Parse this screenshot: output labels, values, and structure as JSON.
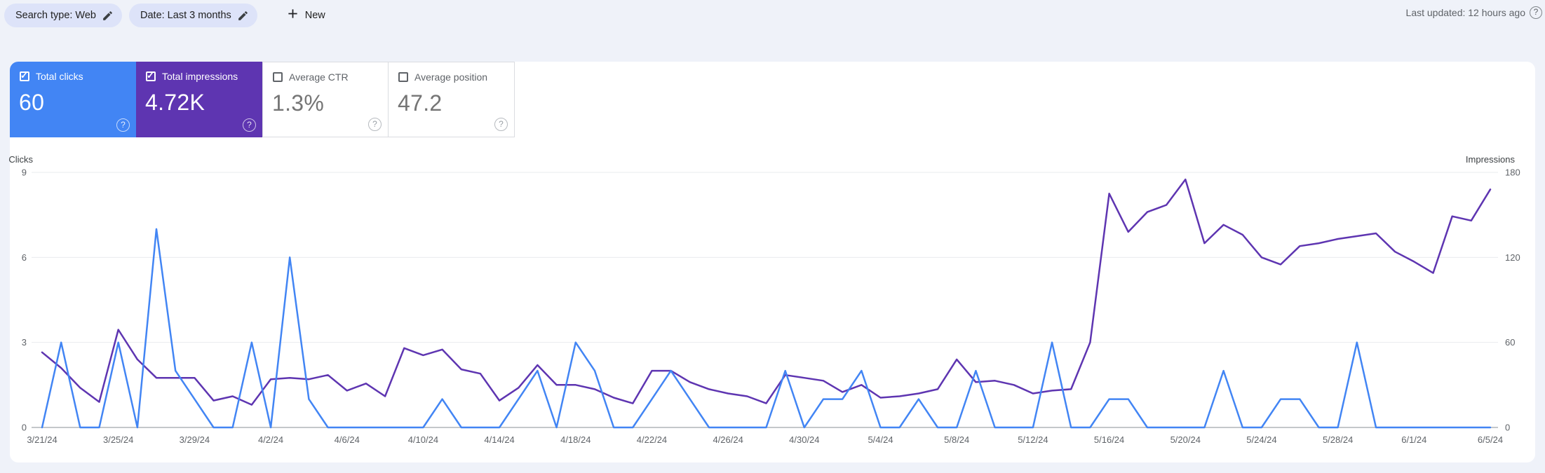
{
  "icons": {
    "help": "?",
    "check": "✓"
  },
  "topbar": {
    "chips": [
      {
        "label": "Search type: Web"
      },
      {
        "label": "Date: Last 3 months"
      }
    ],
    "new_button_label": "New",
    "last_updated": "Last updated: 12 hours ago"
  },
  "cards": [
    {
      "label": "Total clicks",
      "value": "60",
      "checked": true,
      "color": "#4285f4",
      "text": "white"
    },
    {
      "label": "Total impressions",
      "value": "4.72K",
      "checked": true,
      "color": "#5e35b1",
      "text": "white"
    },
    {
      "label": "Average CTR",
      "value": "1.3%",
      "checked": false,
      "color": "#ffffff",
      "text": "gray"
    },
    {
      "label": "Average position",
      "value": "47.2",
      "checked": false,
      "color": "#ffffff",
      "text": "gray"
    }
  ],
  "chart_data": {
    "type": "line",
    "x": [
      "3/21/24",
      "3/22/24",
      "3/23/24",
      "3/24/24",
      "3/25/24",
      "3/26/24",
      "3/27/24",
      "3/28/24",
      "3/29/24",
      "3/30/24",
      "3/31/24",
      "4/1/24",
      "4/2/24",
      "4/3/24",
      "4/4/24",
      "4/5/24",
      "4/6/24",
      "4/7/24",
      "4/8/24",
      "4/9/24",
      "4/10/24",
      "4/11/24",
      "4/12/24",
      "4/13/24",
      "4/14/24",
      "4/15/24",
      "4/16/24",
      "4/17/24",
      "4/18/24",
      "4/19/24",
      "4/20/24",
      "4/21/24",
      "4/22/24",
      "4/23/24",
      "4/24/24",
      "4/25/24",
      "4/26/24",
      "4/27/24",
      "4/28/24",
      "4/29/24",
      "4/30/24",
      "5/1/24",
      "5/2/24",
      "5/3/24",
      "5/4/24",
      "5/5/24",
      "5/6/24",
      "5/7/24",
      "5/8/24",
      "5/9/24",
      "5/10/24",
      "5/11/24",
      "5/12/24",
      "5/13/24",
      "5/14/24",
      "5/15/24",
      "5/16/24",
      "5/17/24",
      "5/18/24",
      "5/19/24",
      "5/20/24",
      "5/21/24",
      "5/22/24",
      "5/23/24",
      "5/24/24",
      "5/25/24",
      "5/26/24",
      "5/27/24",
      "5/28/24",
      "5/29/24",
      "5/30/24",
      "5/31/24",
      "6/1/24",
      "6/2/24",
      "6/3/24",
      "6/4/24",
      "6/5/24"
    ],
    "x_tick_every": 4,
    "series": [
      {
        "name": "Clicks",
        "axis": "left",
        "color": "#4285f4",
        "values": [
          0,
          3,
          0,
          0,
          3,
          0,
          7,
          2,
          1,
          0,
          0,
          3,
          0,
          6,
          1,
          0,
          0,
          0,
          0,
          0,
          0,
          1,
          0,
          0,
          0,
          1,
          2,
          0,
          3,
          2,
          0,
          0,
          1,
          2,
          1,
          0,
          0,
          0,
          0,
          2,
          0,
          1,
          1,
          2,
          0,
          0,
          1,
          0,
          0,
          2,
          0,
          0,
          0,
          3,
          0,
          0,
          1,
          1,
          0,
          0,
          0,
          0,
          2,
          0,
          0,
          1,
          1,
          0,
          0,
          3,
          0,
          0,
          0,
          0,
          0,
          0,
          0
        ]
      },
      {
        "name": "Impressions",
        "axis": "right",
        "color": "#5e35b1",
        "values": [
          53,
          42,
          28,
          18,
          69,
          48,
          35,
          35,
          35,
          19,
          22,
          16,
          34,
          35,
          34,
          37,
          26,
          31,
          22,
          56,
          51,
          55,
          41,
          38,
          19,
          28,
          44,
          30,
          30,
          27,
          21,
          17,
          40,
          40,
          32,
          27,
          24,
          22,
          17,
          37,
          35,
          33,
          25,
          30,
          21,
          22,
          24,
          27,
          48,
          32,
          33,
          30,
          24,
          26,
          27,
          60,
          165,
          138,
          152,
          157,
          175,
          130,
          143,
          136,
          120,
          115,
          128,
          130,
          133,
          135,
          137,
          124,
          117,
          109,
          149,
          146,
          168
        ]
      }
    ],
    "left_axis": {
      "title": "Clicks",
      "ticks": [
        0,
        3,
        6,
        9
      ],
      "max": 9
    },
    "right_axis": {
      "title": "Impressions",
      "ticks": [
        0,
        60,
        120,
        180
      ],
      "max": 180
    },
    "grid": true,
    "legend_position": "none",
    "colors": {
      "grid": "#e9ebee",
      "baseline": "#8a8f94",
      "tick_text": "#5f6368",
      "axis_title_text": "#3c4043"
    }
  }
}
